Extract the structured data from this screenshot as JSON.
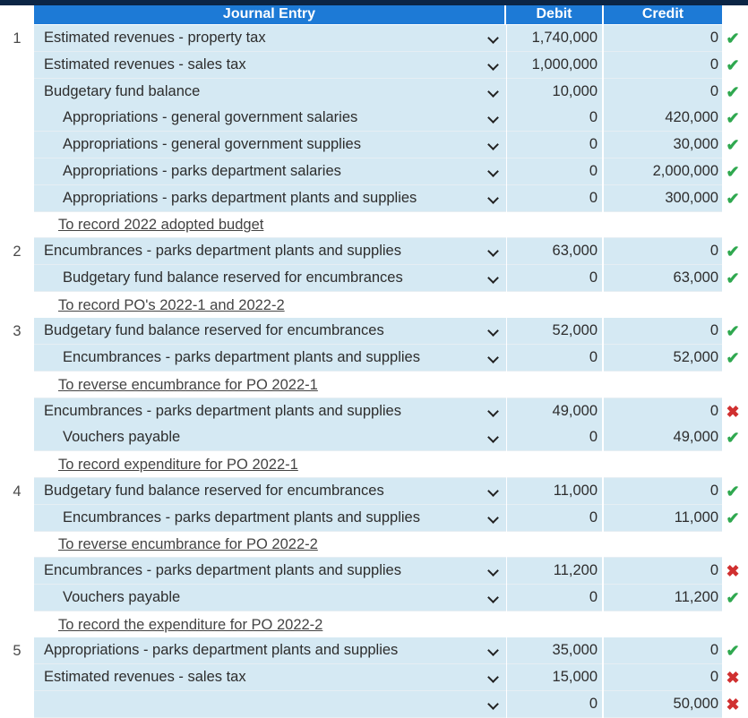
{
  "headers": {
    "entry": "Journal Entry",
    "debit": "Debit",
    "credit": "Credit"
  },
  "rows": [
    {
      "num": "1",
      "account": "Estimated revenues - property tax",
      "indent": false,
      "debit": "1,740,000",
      "credit": "0",
      "mark": "check"
    },
    {
      "num": "",
      "account": "Estimated revenues - sales tax",
      "indent": false,
      "debit": "1,000,000",
      "credit": "0",
      "mark": "check"
    },
    {
      "num": "",
      "account": "Budgetary fund balance",
      "indent": false,
      "debit": "10,000",
      "credit": "0",
      "mark": "check"
    },
    {
      "num": "",
      "account": "Appropriations - general government salaries",
      "indent": true,
      "debit": "0",
      "credit": "420,000",
      "mark": "check"
    },
    {
      "num": "",
      "account": "Appropriations - general government supplies",
      "indent": true,
      "debit": "0",
      "credit": "30,000",
      "mark": "check"
    },
    {
      "num": "",
      "account": "Appropriations - parks department salaries",
      "indent": true,
      "debit": "0",
      "credit": "2,000,000",
      "mark": "check"
    },
    {
      "num": "",
      "account": "Appropriations - parks department plants and supplies",
      "indent": true,
      "debit": "0",
      "credit": "300,000",
      "mark": "check"
    },
    {
      "num": "",
      "note": "To record 2022 adopted budget"
    },
    {
      "num": "2",
      "account": "Encumbrances - parks department plants and supplies",
      "indent": false,
      "debit": "63,000",
      "credit": "0",
      "mark": "check"
    },
    {
      "num": "",
      "account": "Budgetary fund balance reserved for encumbrances",
      "indent": true,
      "debit": "0",
      "credit": "63,000",
      "mark": "check"
    },
    {
      "num": "",
      "note": "To record PO's 2022-1 and 2022-2"
    },
    {
      "num": "3",
      "account": "Budgetary fund balance reserved for encumbrances",
      "indent": false,
      "debit": "52,000",
      "credit": "0",
      "mark": "check"
    },
    {
      "num": "",
      "account": "Encumbrances - parks department plants and supplies",
      "indent": true,
      "debit": "0",
      "credit": "52,000",
      "mark": "check"
    },
    {
      "num": "",
      "note": "To reverse encumbrance for PO 2022-1"
    },
    {
      "num": "",
      "account": "Encumbrances - parks department plants and supplies",
      "indent": false,
      "debit": "49,000",
      "credit": "0",
      "mark": "cross"
    },
    {
      "num": "",
      "account": "Vouchers payable",
      "indent": true,
      "debit": "0",
      "credit": "49,000",
      "mark": "check"
    },
    {
      "num": "",
      "note": "To record expenditure for PO 2022-1"
    },
    {
      "num": "4",
      "account": "Budgetary fund balance reserved for encumbrances",
      "indent": false,
      "debit": "11,000",
      "credit": "0",
      "mark": "check"
    },
    {
      "num": "",
      "account": "Encumbrances - parks department plants and supplies",
      "indent": true,
      "debit": "0",
      "credit": "11,000",
      "mark": "check"
    },
    {
      "num": "",
      "note": "To reverse encumbrance for PO 2022-2"
    },
    {
      "num": "",
      "account": "Encumbrances - parks department plants and supplies",
      "indent": false,
      "debit": "11,200",
      "credit": "0",
      "mark": "cross"
    },
    {
      "num": "",
      "account": "Vouchers payable",
      "indent": true,
      "debit": "0",
      "credit": "11,200",
      "mark": "check"
    },
    {
      "num": "",
      "note": "To record the expenditure for PO 2022-2"
    },
    {
      "num": "5",
      "account": "Appropriations - parks department plants and supplies",
      "indent": false,
      "debit": "35,000",
      "credit": "0",
      "mark": "check"
    },
    {
      "num": "",
      "account": "Estimated revenues - sales tax",
      "indent": false,
      "debit": "15,000",
      "credit": "0",
      "mark": "cross"
    },
    {
      "num": "",
      "account": "",
      "indent": false,
      "debit": "0",
      "credit": "50,000",
      "mark": "cross"
    }
  ]
}
